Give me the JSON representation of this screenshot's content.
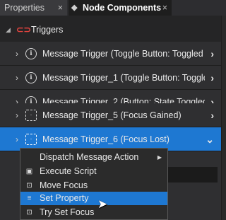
{
  "tabs": [
    {
      "label": "Properties",
      "close": "×",
      "active": false
    },
    {
      "label": "Node Components",
      "close": "×",
      "active": true
    }
  ],
  "group": {
    "label": "Triggers",
    "expander": "◢",
    "icon": "link-icon"
  },
  "triggers": [
    {
      "label": "Message Trigger (Toggle Button: Toggled O",
      "icon": "message-trigger-icon",
      "chevron": "›"
    },
    {
      "label": "Message Trigger_1 (Toggle Button: Toggled",
      "icon": "message-trigger-icon",
      "chevron": "›"
    },
    {
      "label": "Message Trigger_2 (Button: State Toggled)",
      "icon": "message-trigger-icon",
      "chevron": "›"
    },
    {
      "label": "Message Trigger_5 (Focus Gained)",
      "icon": "focus-trigger-icon",
      "chevron": "›"
    },
    {
      "label": "Message Trigger_6 (Focus Lost)",
      "icon": "focus-trigger-icon",
      "chevron": "⌄",
      "selected": true
    }
  ],
  "context_menu": {
    "items": [
      {
        "label": "Dispatch Message Action",
        "submenu": "▶"
      },
      {
        "label": "Execute Script",
        "icon": "script-icon"
      },
      {
        "label": "Move Focus",
        "icon": "focus-icon"
      },
      {
        "label": "Set Property",
        "icon": "set-property-icon",
        "highlighted": true
      },
      {
        "label": "Try Set Focus",
        "icon": "focus-icon"
      }
    ]
  },
  "colors": {
    "accent": "#1e78d2",
    "panel": "#2f2f31",
    "background": "#1e1e1e"
  }
}
